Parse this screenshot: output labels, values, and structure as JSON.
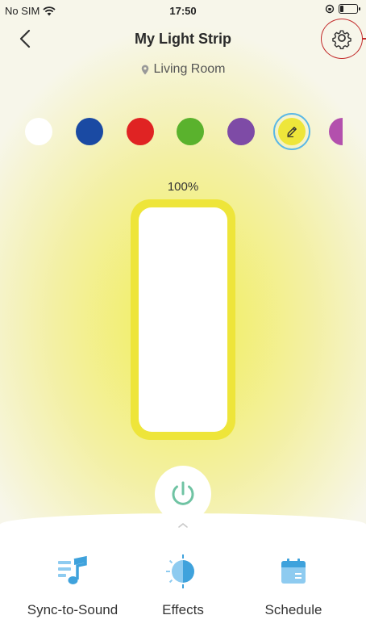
{
  "status_bar": {
    "carrier": "No SIM",
    "time": "17:50"
  },
  "header": {
    "title": "My Light Strip",
    "location": "Living Room"
  },
  "colors": {
    "swatches": [
      "#ffffff",
      "#1a4aa3",
      "#e02323",
      "#5ab22d",
      "#7e4ba6"
    ],
    "custom_color": "#eee63a",
    "partial_swatch": "#b350ad",
    "selected": "custom"
  },
  "brightness": {
    "label": "100%",
    "level": 1.0
  },
  "power": {
    "state": "on",
    "color": "#6fc3a3"
  },
  "actions": [
    {
      "label": "Sync-to-Sound",
      "icon": "music-icon"
    },
    {
      "label": "Effects",
      "icon": "effects-icon"
    },
    {
      "label": "Schedule",
      "icon": "calendar-icon"
    }
  ],
  "accent": "#3fa2dc"
}
